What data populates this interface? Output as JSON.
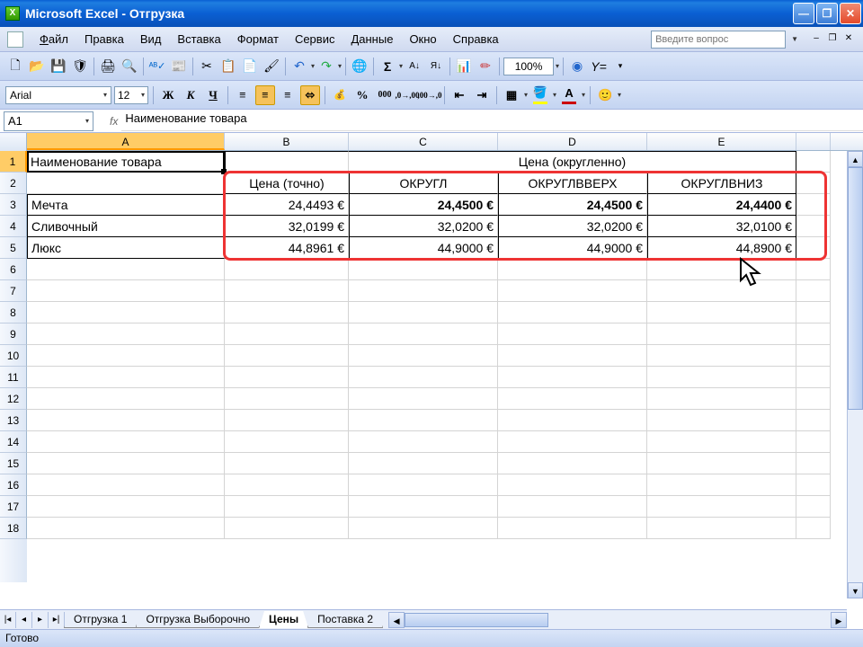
{
  "app_title": "Microsoft Excel - Отгрузка",
  "menu": {
    "file": "Файл",
    "edit": "Правка",
    "view": "Вид",
    "insert": "Вставка",
    "format": "Формат",
    "tools": "Сервис",
    "data": "Данные",
    "window": "Окно",
    "help": "Справка"
  },
  "ask": {
    "placeholder": "Введите вопрос"
  },
  "zoom": "100%",
  "font": {
    "name": "Arial",
    "size": "12"
  },
  "name_box": "A1",
  "formula_bar": "Наименование товара",
  "columns": [
    "A",
    "B",
    "C",
    "D",
    "E"
  ],
  "rows_visible": 18,
  "header_merged_title": "Цена (округленно)",
  "table": {
    "h1a": "Наименование товара",
    "h2b": "Цена (точно)",
    "h2c": "ОКРУГЛ",
    "h2d": "ОКРУГЛВВЕРХ",
    "h2e": "ОКРУГЛВНИЗ",
    "r3": {
      "a": "Мечта",
      "b": "24,4493 €",
      "c": "24,4500 €",
      "d": "24,4500 €",
      "e": "24,4400 €"
    },
    "r4": {
      "a": "Сливочный",
      "b": "32,0199 €",
      "c": "32,0200 €",
      "d": "32,0200 €",
      "e": "32,0100 €"
    },
    "r5": {
      "a": "Люкс",
      "b": "44,8961 €",
      "c": "44,9000 €",
      "d": "44,9000 €",
      "e": "44,8900 €"
    }
  },
  "sheets": {
    "s1": "Отгрузка 1",
    "s2": "Отгрузка Выборочно",
    "s3": "Цены",
    "s4": "Поставка 2"
  },
  "status": "Готово"
}
